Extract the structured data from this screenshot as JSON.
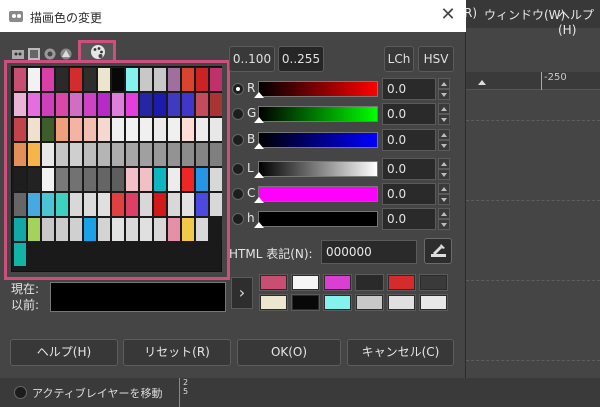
{
  "dialog": {
    "title": "描画色の変更",
    "close_glyph": "✕"
  },
  "background": {
    "menu": [
      "R)",
      "ウィンドウ(W)",
      "ヘルプ(H)"
    ],
    "ruler_label": "-250",
    "bottom_option": "アクティブレイヤーを移動",
    "vruler_text": "2\n5"
  },
  "palette_tabs": [
    "gimp-wilber-icon",
    "scales-icon",
    "wheel-icon",
    "triangle-icon",
    "palette-icon"
  ],
  "palette": {
    "rows": [
      [
        "#c94f72",
        "#f2f2f2",
        "#d93fa7",
        "#2a2a2a",
        "#d42c2c",
        "#2e2e2e",
        "#ede6cf",
        "#080808",
        "#85f2ee",
        "#c8c8c8",
        "#c8c8c8",
        "#9f6f9f",
        "#d9442e",
        "#cc2222",
        "#c0306a"
      ],
      [
        "#e9b4d6",
        "#e46ee0",
        "#cf3fb9",
        "#d948a8",
        "#d16ec3",
        "#cf42c4",
        "#b829c9",
        "#e07fd9",
        "#e43fdd",
        "#2525a8",
        "#1b1bb0",
        "#403ac2",
        "#4235c9",
        "#c54a5a",
        "#aa3333"
      ],
      [
        "#c0444a",
        "#f2e0ce",
        "#3e5d2a",
        "#eda07a",
        "#f4b3a3",
        "#f2c0b0",
        "#f5d9d0",
        "#f0f0f0",
        "#f2f2f2",
        "#f0f0f0",
        "#ececec",
        "#f0f0f0",
        "#ffdcd6",
        "#ececec",
        "#e8e8e8"
      ],
      [
        "#e5905a",
        "#f6b44a",
        "#e8e8e8",
        "#c6c6c6",
        "#cfcfcf",
        "#bdbdbd",
        "#b5b5b5",
        "#adadad",
        "#a6a6a6",
        "#a0a0a0",
        "#999999",
        "#939393",
        "#8c8c8c",
        "#858585",
        "#7f7f7f"
      ],
      [
        "#1e1e1e",
        "#222222",
        "#f2f2f2",
        "#797979",
        "#727272",
        "#6b6b6b",
        "#656565",
        "#5e5e5e",
        "#f3c0c8",
        "#f0c0c4",
        "#0fb5c0",
        "#ececec",
        "#ee2626",
        "#2496e5",
        "#d8d8d8"
      ],
      [
        "#666666",
        "#48a8e0",
        "#4dc4d4",
        "#3ed0c0",
        "#d8d8d8",
        "#dcdcdc",
        "#e0e0e0",
        "#e04040",
        "#dd3f65",
        "#d8d8d8",
        "#d11a1a",
        "#d8d8d8",
        "#e2e2e2",
        "#4a4ae0",
        "#d8d8d8"
      ],
      [
        "#14a7a7",
        "#a4d25a",
        "#c8c8c8",
        "#cccccc",
        "#d0d0d0",
        "#1aa2e6",
        "#d4d4d4",
        "#e2e2e2",
        "#dadada",
        "#e0e0e0",
        "#d8d8d8",
        "#e88fa8",
        "#f2c84a",
        "#d8d8d8",
        "#1a1a1a"
      ],
      [
        "#13b4a8"
      ]
    ]
  },
  "labels": {
    "current": "現在:",
    "previous": "以前:",
    "expand": "›"
  },
  "scale_buttons": {
    "b100": "0..100",
    "b255": "0..255",
    "lch": "LCh",
    "hsv": "HSV"
  },
  "channels": [
    {
      "label": "R",
      "value": "0.0",
      "gradient": [
        "#000000",
        "#ff0000"
      ],
      "checked": true
    },
    {
      "label": "G",
      "value": "0.0",
      "gradient": [
        "#000000",
        "#00ff00"
      ],
      "checked": false
    },
    {
      "label": "B",
      "value": "0.0",
      "gradient": [
        "#000000",
        "#0000ff"
      ],
      "checked": false
    },
    {
      "label": "L",
      "value": "0.0",
      "gradient": [
        "#000000",
        "#ffffff"
      ],
      "checked": false
    },
    {
      "label": "C",
      "value": "0.0",
      "gradient": [
        "#ff00ff",
        "#ff00ff"
      ],
      "checked": false
    },
    {
      "label": "h",
      "value": "0.0",
      "gradient": [
        "#000000",
        "#000000"
      ],
      "checked": false
    }
  ],
  "html_notation": {
    "label": "HTML 表記(N):",
    "value": "000000"
  },
  "history": [
    "#c94f72",
    "#f5f5f5",
    "#d93fd0",
    "#2a2a2a",
    "#d42c2c",
    "#3a3a3a",
    "#ede6cf",
    "#080808",
    "#85f2ee",
    "#c8c8c8",
    "#e0e0e0",
    "#e8e8e8"
  ],
  "buttons": {
    "help": "ヘルプ(H)",
    "reset": "リセット(R)",
    "ok": "OK(O)",
    "cancel": "キャンセル(C)"
  },
  "colors": {
    "highlight": "#cc4f7d"
  }
}
